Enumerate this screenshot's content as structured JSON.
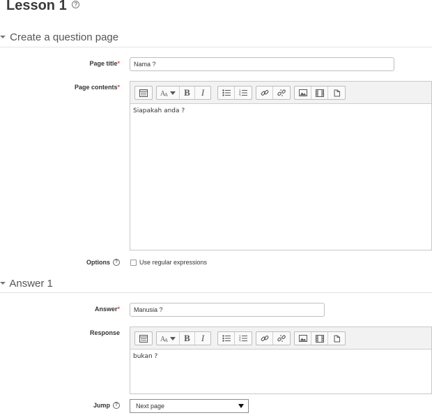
{
  "lesson": {
    "title": "Lesson 1",
    "help_glyph": "?"
  },
  "sections": {
    "question": {
      "title": "Create a question page"
    },
    "answer": {
      "title": "Answer 1"
    }
  },
  "form": {
    "page_title": {
      "label": "Page title",
      "required_mark": "*",
      "value": "Nama ?"
    },
    "page_contents": {
      "label": "Page contents",
      "required_mark": "*",
      "content": "Siapakah anda ?"
    },
    "options": {
      "label": "Options",
      "help_glyph": "?",
      "checkbox_label": "Use regular expressions",
      "checked": false
    },
    "answer": {
      "label": "Answer",
      "required_mark": "*",
      "value": "Manusia ?"
    },
    "response": {
      "label": "Response",
      "content": "bukan ?"
    },
    "jump": {
      "label": "Jump",
      "help_glyph": "?",
      "selected": "Next page"
    }
  },
  "toolbar": {
    "icons": [
      "show-more-buttons-icon",
      "font-style-icon",
      "bold-icon",
      "italic-icon",
      "unordered-list-icon",
      "ordered-list-icon",
      "link-icon",
      "unlink-icon",
      "insert-image-icon",
      "insert-media-icon",
      "manage-files-icon"
    ],
    "bold_glyph": "B",
    "italic_glyph": "I"
  }
}
